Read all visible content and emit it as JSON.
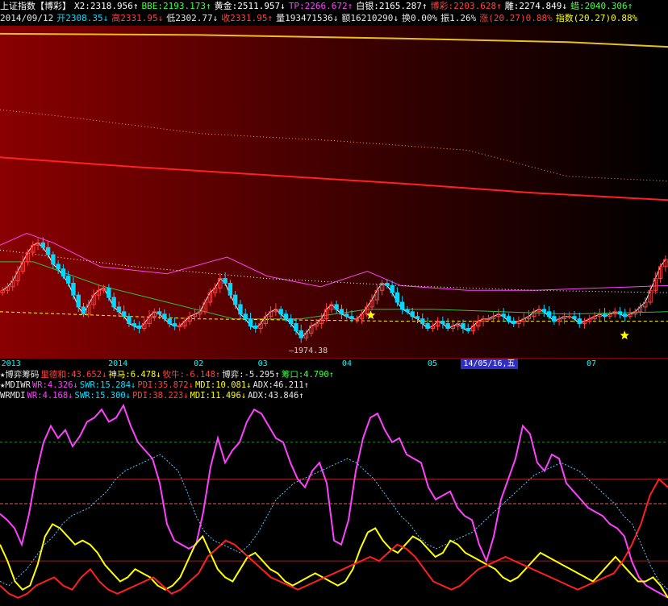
{
  "header": {
    "row1": [
      {
        "t": "上证指数【博彩】",
        "c": "#ffffff"
      },
      {
        "t": "X2:2318.956↑",
        "c": "#ffffff"
      },
      {
        "t": "BBE:2193.173↑",
        "c": "#40ff40"
      },
      {
        "t": "黄金:2511.957↓",
        "c": "#ffffff"
      },
      {
        "t": "TP:2266.672↑",
        "c": "#ff40ff"
      },
      {
        "t": "白银:2165.287↑",
        "c": "#ffffff"
      },
      {
        "t": "博彩:2203.628↑",
        "c": "#ff4040"
      },
      {
        "t": "雕:2274.849↓",
        "c": "#ffffff"
      },
      {
        "t": "蜡:2040.306↑",
        "c": "#40ff40"
      }
    ],
    "row2": [
      {
        "t": "2014/09/12",
        "c": "#e8e8e8"
      },
      {
        "t": "开2308.35↓",
        "c": "#00e0ff"
      },
      {
        "t": "高2331.95↓",
        "c": "#ff4040"
      },
      {
        "t": "低2302.77↓",
        "c": "#e8e8e8"
      },
      {
        "t": "收2331.95↑",
        "c": "#ff4040"
      },
      {
        "t": "量193471536↓",
        "c": "#e8e8e8"
      },
      {
        "t": "额16210290↓",
        "c": "#e8e8e8"
      },
      {
        "t": "换0.00%",
        "c": "#e8e8e8"
      },
      {
        "t": "振1.26%",
        "c": "#e8e8e8"
      },
      {
        "t": "涨(20.27)0.88%",
        "c": "#ff4040"
      },
      {
        "t": "指数(20.27)0.88%",
        "c": "#ffff00"
      }
    ]
  },
  "annotations": {
    "low_label": "—1974.38"
  },
  "date_axis": [
    {
      "label": "2013",
      "frac": 0.002
    },
    {
      "label": "2014",
      "frac": 0.162
    },
    {
      "label": "02",
      "frac": 0.29
    },
    {
      "label": "03",
      "frac": 0.386
    },
    {
      "label": "04",
      "frac": 0.512
    },
    {
      "label": "05",
      "frac": 0.64
    },
    {
      "label": "14/05/16,五",
      "frac": 0.69,
      "selected": true
    },
    {
      "label": "07",
      "frac": 0.878
    }
  ],
  "indicators": {
    "row1": [
      {
        "t": "★博弈筹码",
        "c": "#e8e8e8"
      },
      {
        "t": "里德和:43.652↓",
        "c": "#ff4040"
      },
      {
        "t": "神马:6.478↓",
        "c": "#ffff00"
      },
      {
        "t": "牧牛:-6.148↑",
        "c": "#ff4040"
      },
      {
        "t": "博弈:-5.295↑",
        "c": "#e8e8e8"
      },
      {
        "t": "筹口:4.790↑",
        "c": "#40ff40"
      }
    ],
    "row2": [
      {
        "t": "★MDIWR",
        "c": "#e8e8e8"
      },
      {
        "t": "WR:4.326↓",
        "c": "#ff40ff"
      },
      {
        "t": "SWR:15.284↓",
        "c": "#00e0ff"
      },
      {
        "t": "PDI:35.872↓",
        "c": "#ff4040"
      },
      {
        "t": "MDI:10.081↓",
        "c": "#ffff00"
      },
      {
        "t": "ADX:46.211↑",
        "c": "#e8e8e8"
      }
    ],
    "row3": [
      {
        "t": "WRMDI",
        "c": "#e8e8e8"
      },
      {
        "t": "WR:4.168↓",
        "c": "#ff40ff"
      },
      {
        "t": "SWR:15.300↓",
        "c": "#00e0ff"
      },
      {
        "t": "PDI:38.223↓",
        "c": "#ff4040"
      },
      {
        "t": "MDI:11.496↓",
        "c": "#ffff00"
      },
      {
        "t": "ADX:43.846↑",
        "c": "#e8e8e8"
      }
    ]
  },
  "chart_data": [
    {
      "type": "candlestick",
      "ylim": [
        1950,
        3300
      ],
      "grid": false,
      "overlay_lines": [
        {
          "color": "#e8c020",
          "style": "solid",
          "x": [
            0,
            0.3,
            0.6,
            0.85,
            1
          ],
          "y": [
            3280,
            3275,
            3260,
            3245,
            3225
          ]
        },
        {
          "color": "#ff9060",
          "style": "dotted",
          "x": [
            0,
            0.1,
            0.3,
            0.5,
            0.7,
            0.85,
            1
          ],
          "y": [
            2960,
            2930,
            2860,
            2830,
            2790,
            2680,
            2660
          ]
        },
        {
          "color": "#ff2020",
          "style": "solid",
          "x": [
            0,
            0.2,
            0.4,
            0.6,
            0.8,
            1
          ],
          "y": [
            2760,
            2720,
            2685,
            2650,
            2610,
            2580
          ]
        },
        {
          "color": "#ff40ff",
          "style": "solid",
          "x": [
            0,
            0.04,
            0.08,
            0.15,
            0.25,
            0.34,
            0.4,
            0.48,
            0.55,
            0.6,
            0.7,
            0.8,
            0.9,
            1
          ],
          "y": [
            2390,
            2440,
            2400,
            2300,
            2270,
            2340,
            2260,
            2215,
            2280,
            2220,
            2200,
            2200,
            2210,
            2220
          ]
        },
        {
          "color": "#ffffff",
          "style": "dotted",
          "x": [
            0,
            0.2,
            0.4,
            0.6,
            0.8,
            1
          ],
          "y": [
            2370,
            2300,
            2250,
            2220,
            2200,
            2190
          ]
        },
        {
          "color": "#30c040",
          "style": "solid",
          "x": [
            0,
            0.05,
            0.15,
            0.25,
            0.35,
            0.45,
            0.55,
            0.65,
            0.75,
            0.85,
            1
          ],
          "y": [
            2320,
            2320,
            2220,
            2150,
            2080,
            2080,
            2120,
            2120,
            2110,
            2100,
            2110
          ]
        },
        {
          "color": "#ffff00",
          "style": "dashed",
          "x": [
            0,
            0.3,
            0.6,
            1
          ],
          "y": [
            2110,
            2080,
            2070,
            2070
          ]
        }
      ],
      "closes": [
        2200,
        2215,
        2240,
        2280,
        2320,
        2360,
        2390,
        2400,
        2380,
        2350,
        2310,
        2290,
        2260,
        2230,
        2180,
        2130,
        2100,
        2140,
        2180,
        2200,
        2210,
        2170,
        2130,
        2110,
        2090,
        2060,
        2050,
        2040,
        2060,
        2090,
        2110,
        2100,
        2080,
        2060,
        2050,
        2050,
        2070,
        2090,
        2100,
        2110,
        2150,
        2190,
        2210,
        2250,
        2230,
        2180,
        2140,
        2100,
        2080,
        2050,
        2040,
        2060,
        2090,
        2110,
        2120,
        2100,
        2080,
        2060,
        2030,
        2000,
        2020,
        2050,
        2060,
        2080,
        2120,
        2140,
        2120,
        2100,
        2090,
        2080,
        2080,
        2100,
        2130,
        2160,
        2200,
        2230,
        2220,
        2190,
        2150,
        2120,
        2110,
        2090,
        2080,
        2060,
        2040,
        2050,
        2070,
        2060,
        2040,
        2050,
        2060,
        2040,
        2030,
        2050,
        2070,
        2080,
        2080,
        2090,
        2100,
        2090,
        2070,
        2060,
        2070,
        2080,
        2090,
        2110,
        2120,
        2110,
        2090,
        2070,
        2080,
        2090,
        2090,
        2080,
        2060,
        2070,
        2080,
        2090,
        2100,
        2090,
        2100,
        2110,
        2100,
        2090,
        2100,
        2110,
        2130,
        2150,
        2200,
        2250,
        2300,
        2330
      ],
      "low_label_value": 1974.38,
      "stars": [
        {
          "frac": 0.555,
          "y": 2095
        },
        {
          "frac": 0.935,
          "y": 2010
        }
      ]
    },
    {
      "type": "line",
      "ylim": [
        0,
        100
      ],
      "hlines": [
        {
          "y": 80,
          "color": "#2d8a2d"
        },
        {
          "y": 62,
          "color": "#902020"
        },
        {
          "y": 50,
          "color": "#e06060"
        },
        {
          "y": 22,
          "color": "#902020"
        }
      ],
      "series": [
        {
          "color": "#ff40ff",
          "values": [
            45,
            42,
            38,
            30,
            45,
            65,
            80,
            88,
            82,
            86,
            78,
            83,
            90,
            92,
            96,
            90,
            92,
            98,
            88,
            80,
            76,
            72,
            60,
            40,
            32,
            30,
            28,
            30,
            46,
            68,
            82,
            70,
            76,
            80,
            90,
            96,
            94,
            88,
            82,
            80,
            70,
            62,
            58,
            66,
            70,
            60,
            32,
            30,
            42,
            66,
            82,
            92,
            94,
            86,
            80,
            82,
            74,
            72,
            70,
            58,
            52,
            54,
            56,
            48,
            44,
            42,
            30,
            22,
            34,
            52,
            62,
            72,
            88,
            84,
            70,
            66,
            74,
            72,
            60,
            56,
            52,
            48,
            46,
            44,
            40,
            38,
            34,
            22,
            14,
            10,
            8,
            6,
            4
          ]
        },
        {
          "color": "#ffff00",
          "values": [
            30,
            22,
            12,
            8,
            10,
            20,
            34,
            40,
            38,
            34,
            30,
            32,
            30,
            26,
            20,
            16,
            12,
            14,
            18,
            16,
            14,
            10,
            8,
            10,
            14,
            22,
            30,
            34,
            26,
            18,
            14,
            12,
            18,
            24,
            26,
            22,
            18,
            16,
            12,
            10,
            12,
            14,
            16,
            14,
            12,
            10,
            12,
            18,
            28,
            36,
            38,
            32,
            28,
            26,
            30,
            34,
            32,
            28,
            24,
            26,
            32,
            30,
            26,
            24,
            22,
            20,
            18,
            14,
            12,
            14,
            18,
            22,
            26,
            24,
            22,
            20,
            18,
            16,
            14,
            12,
            16,
            20,
            24,
            20,
            16,
            12,
            12,
            14,
            10,
            4
          ]
        },
        {
          "color": "#ff2020",
          "values": [
            10,
            6,
            4,
            6,
            10,
            12,
            14,
            10,
            8,
            14,
            18,
            12,
            8,
            6,
            8,
            10,
            12,
            14,
            10,
            6,
            8,
            12,
            16,
            24,
            28,
            32,
            30,
            26,
            22,
            18,
            14,
            12,
            10,
            8,
            10,
            12,
            14,
            16,
            18,
            20,
            22,
            24,
            22,
            26,
            30,
            28,
            24,
            18,
            12,
            10,
            8,
            10,
            14,
            18,
            20,
            22,
            24,
            22,
            20,
            18,
            16,
            14,
            12,
            10,
            8,
            10,
            12,
            14,
            16,
            22,
            30,
            40,
            54,
            62,
            58
          ]
        },
        {
          "color": "#60c0ff",
          "values": [
            12,
            10,
            14,
            18,
            24,
            30,
            34,
            40,
            44,
            46,
            48,
            52,
            56,
            62,
            66,
            68,
            70,
            72,
            74,
            70,
            66,
            56,
            44,
            36,
            32,
            30,
            28,
            26,
            30,
            36,
            44,
            52,
            56,
            60,
            62,
            64,
            66,
            68,
            70,
            72,
            70,
            66,
            62,
            56,
            50,
            44,
            40,
            34,
            30,
            28,
            30,
            32,
            34,
            36,
            40,
            44,
            48,
            52,
            56,
            60,
            64,
            66,
            68,
            70,
            68,
            66,
            62,
            58,
            54,
            50,
            44,
            40,
            30,
            20,
            12,
            8
          ]
        }
      ]
    }
  ]
}
